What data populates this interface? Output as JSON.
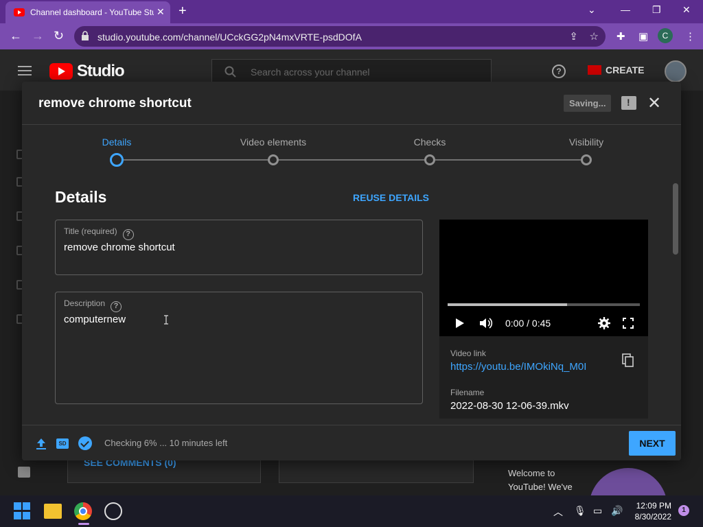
{
  "browser": {
    "tab_title": "Channel dashboard - YouTube Studio",
    "url": "studio.youtube.com/channel/UCckGG2pN4mxVRTE-psdDOfA",
    "profile_initial": "C"
  },
  "studio": {
    "logo_text": "Studio",
    "search_placeholder": "Search across your channel",
    "create_label": "CREATE",
    "bg_link": "SEE COMMENTS (0)",
    "welcome_text": "Welcome to YouTube! We've"
  },
  "modal": {
    "title": "remove chrome shortcut",
    "saving_label": "Saving...",
    "steps": [
      {
        "label": "Details",
        "active": true
      },
      {
        "label": "Video elements",
        "active": false
      },
      {
        "label": "Checks",
        "active": false
      },
      {
        "label": "Visibility",
        "active": false
      }
    ],
    "section_heading": "Details",
    "reuse_label": "REUSE DETAILS",
    "title_field": {
      "label": "Title (required)",
      "value": "remove chrome shortcut"
    },
    "description_field": {
      "label": "Description",
      "value": "computernew"
    },
    "video": {
      "time": "0:00 / 0:45",
      "progress": 0.62,
      "link_label": "Video link",
      "link": "https://youtu.be/IMOkiNq_M0I",
      "filename_label": "Filename",
      "filename": "2022-08-30 12-06-39.mkv"
    },
    "footer": {
      "sd_badge": "SD",
      "status": "Checking 6% ... 10 minutes left",
      "next_label": "NEXT"
    }
  },
  "taskbar": {
    "time": "12:09 PM",
    "date": "8/30/2022",
    "notification_count": "1"
  },
  "colors": {
    "accent": "#3ea6ff",
    "chrome_frame": "#7a4cb0",
    "modal_bg": "#282828"
  }
}
